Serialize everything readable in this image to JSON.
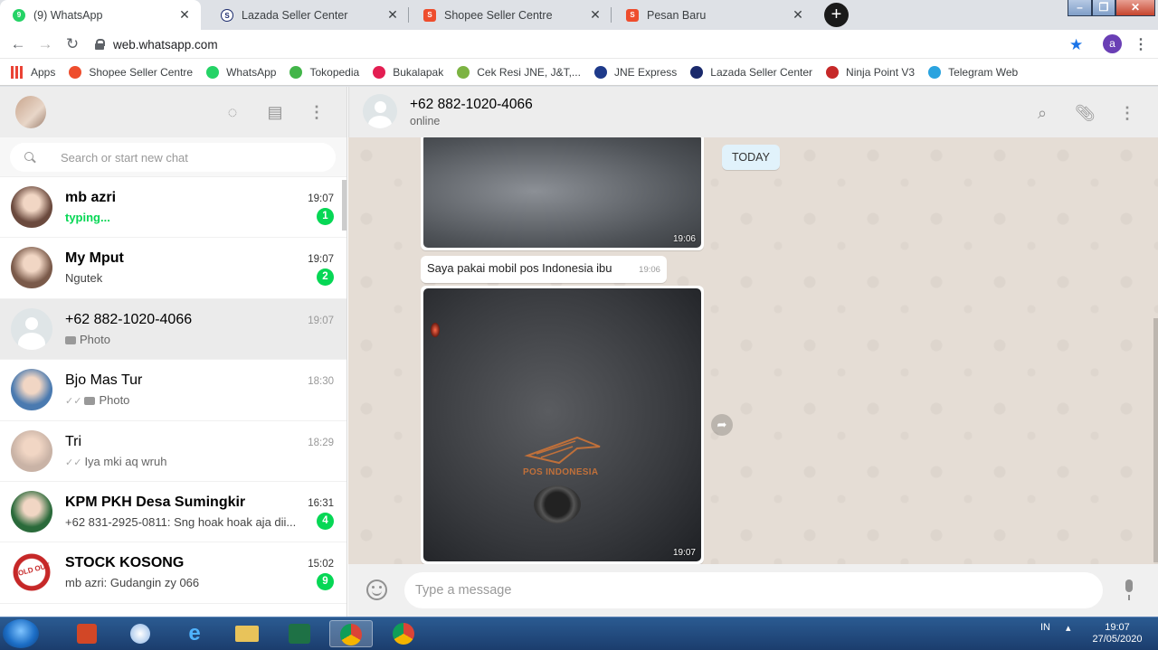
{
  "browser": {
    "tabs": [
      {
        "title": "(9) WhatsApp",
        "icon": "whatsapp-icon",
        "color": "#25d366",
        "glyph": "9",
        "active": true
      },
      {
        "title": "Lazada Seller Center",
        "icon": "lazada-icon",
        "color": "#1a2a6c",
        "glyph": "S",
        "active": false
      },
      {
        "title": "Shopee Seller Centre",
        "icon": "shopee-icon",
        "color": "#ee4d2d",
        "glyph": "S",
        "active": false
      },
      {
        "title": "Pesan Baru",
        "icon": "shopee-icon",
        "color": "#ee4d2d",
        "glyph": "S",
        "active": false
      }
    ],
    "url": "web.whatsapp.com",
    "profile_initial": "a",
    "bookmarks": [
      {
        "label": "Apps",
        "icon": "apps-grid-icon",
        "color": "#4285f4"
      },
      {
        "label": "Shopee Seller Centre",
        "icon": "shopee-icon",
        "color": "#ee4d2d"
      },
      {
        "label": "WhatsApp",
        "icon": "whatsapp-icon",
        "color": "#25d366"
      },
      {
        "label": "Tokopedia",
        "icon": "tokopedia-icon",
        "color": "#42b549"
      },
      {
        "label": "Bukalapak",
        "icon": "bukalapak-icon",
        "color": "#e31e52"
      },
      {
        "label": "Cek Resi JNE, J&T,...",
        "icon": "cek-resi-icon",
        "color": "#7cb342"
      },
      {
        "label": "JNE Express",
        "icon": "jne-icon",
        "color": "#1e3a8a"
      },
      {
        "label": "Lazada Seller Center",
        "icon": "lazada-icon",
        "color": "#1a2a6c"
      },
      {
        "label": "Ninja Point V3",
        "icon": "ninja-icon",
        "color": "#c62828"
      },
      {
        "label": "Telegram Web",
        "icon": "telegram-icon",
        "color": "#2aa3df"
      }
    ]
  },
  "sidebar": {
    "search_placeholder": "Search or start new chat",
    "chats": [
      {
        "name": "mb azri",
        "time": "19:07",
        "last": "typing...",
        "unread": "1",
        "bold": true,
        "typing": true,
        "avatar": "#6b4a3e"
      },
      {
        "name": "My Mput",
        "time": "19:07",
        "last": "Ngutek",
        "unread": "2",
        "bold": true,
        "typing": false,
        "avatar": "#7a5a4a"
      },
      {
        "name": "+62 882-1020-4066",
        "time": "19:07",
        "last": "Photo",
        "unread": "",
        "bold": false,
        "typing": false,
        "photo": true,
        "selected": true,
        "avatar": "#dfe5e7"
      },
      {
        "name": "Bjo Mas Tur",
        "time": "18:30",
        "last": "Photo",
        "unread": "",
        "bold": false,
        "typing": false,
        "photo": true,
        "ticks": true,
        "avatar": "#4a7ab0"
      },
      {
        "name": "Tri",
        "time": "18:29",
        "last": "Iya mki aq wruh",
        "unread": "",
        "bold": false,
        "typing": false,
        "ticks": true,
        "avatar": "#c9b3a6"
      },
      {
        "name": "KPM PKH Desa Sumingkir",
        "time": "16:31",
        "last": "+62 831-2925-0811: Sng hoak hoak aja dii...",
        "unread": "4",
        "bold": true,
        "typing": false,
        "avatar": "#2a6a3a"
      },
      {
        "name": "STOCK KOSONG",
        "time": "15:02",
        "last": "mb azri: Gudangin zy 066",
        "unread": "9",
        "bold": true,
        "typing": false,
        "avatar": "#c62828",
        "avatar_text": "SOLD OUT"
      }
    ]
  },
  "conversation": {
    "contact": "+62 882-1020-4066",
    "status": "online",
    "date_chip": "TODAY",
    "messages": [
      {
        "type": "image",
        "time": "19:06"
      },
      {
        "type": "text",
        "text": "Saya pakai mobil pos Indonesia ibu",
        "time": "19:06"
      },
      {
        "type": "image",
        "time": "19:07",
        "caption_in_image": "POS INDONESIA"
      }
    ],
    "input_placeholder": "Type a message"
  },
  "taskbar": {
    "lang": "IN",
    "time": "19:07",
    "date": "27/05/2020"
  }
}
